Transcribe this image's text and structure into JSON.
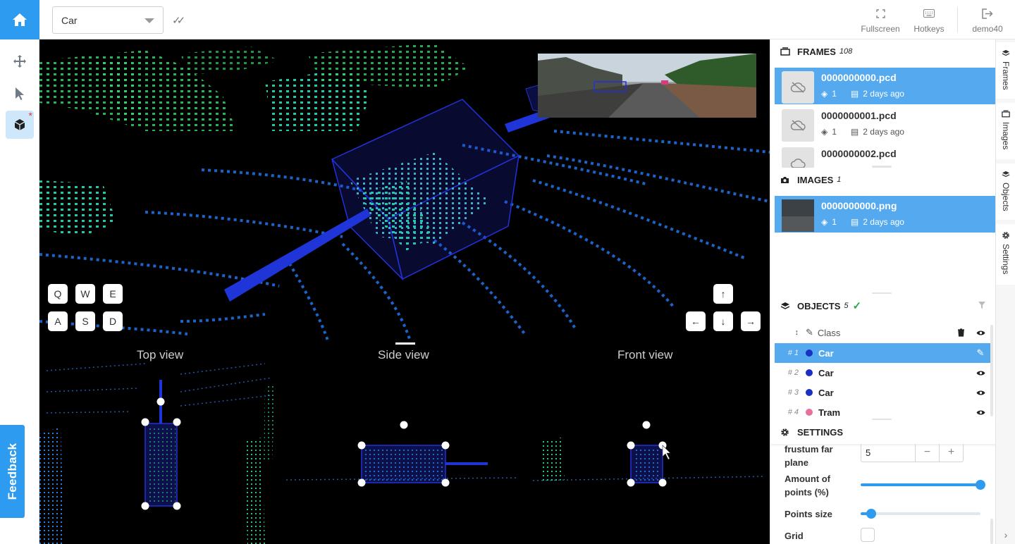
{
  "top_bar": {
    "class_select_value": "Car",
    "fullscreen_label": "Fullscreen",
    "hotkeys_label": "Hotkeys",
    "user_label": "demo40"
  },
  "viewport": {
    "keys": [
      "Q",
      "W",
      "E",
      "A",
      "S",
      "D"
    ],
    "arrow_keys": [
      "↑",
      "←",
      "↓",
      "→"
    ],
    "views": [
      "Top view",
      "Side view",
      "Front view"
    ]
  },
  "frames": {
    "title": "FRAMES",
    "count": "108",
    "items": [
      {
        "name": "0000000000.pcd",
        "layers": "1",
        "time": "2 days ago"
      },
      {
        "name": "0000000001.pcd",
        "layers": "1",
        "time": "2 days ago"
      },
      {
        "name": "0000000002.pcd",
        "layers": "",
        "time": ""
      }
    ]
  },
  "images": {
    "title": "IMAGES",
    "count": "1",
    "items": [
      {
        "name": "0000000000.png",
        "layers": "1",
        "time": "2 days ago"
      }
    ]
  },
  "objects": {
    "title": "OBJECTS",
    "count": "5",
    "class_header": "Class",
    "items": [
      {
        "num": "1",
        "class": "Car",
        "color": "#1a2fc4"
      },
      {
        "num": "2",
        "class": "Car",
        "color": "#1a2fc4"
      },
      {
        "num": "3",
        "class": "Car",
        "color": "#1a2fc4"
      },
      {
        "num": "4",
        "class": "Tram",
        "color": "#e8709c"
      }
    ]
  },
  "settings": {
    "title": "SETTINGS",
    "frustum_label": "frustum far plane",
    "frustum_value": "5",
    "amount_label": "Amount of points (%)",
    "amount_value": 1.0,
    "points_size_label": "Points size",
    "points_size_value": 0.09,
    "grid_label": "Grid"
  },
  "side_tabs": [
    "Frames",
    "Images",
    "Objects",
    "Settings"
  ],
  "feedback_label": "Feedback",
  "colors": {
    "accent": "#2d9bf0",
    "selected_row": "#54a9ef"
  }
}
